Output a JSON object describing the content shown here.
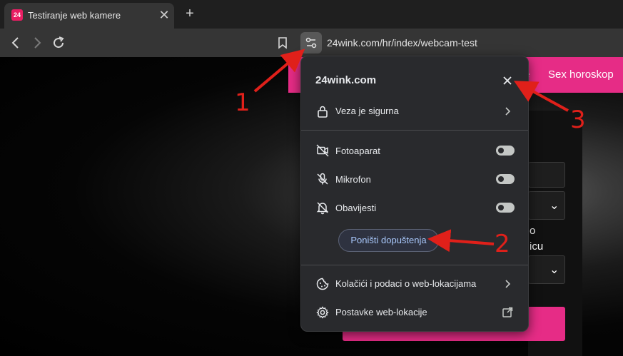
{
  "tab": {
    "favicon_text": "24",
    "title": "Testiranje web kamere",
    "close": "✕"
  },
  "new_tab": "+",
  "toolbar": {
    "url": "24wink.com/hr/index/webcam-test"
  },
  "page": {
    "nav_links": [
      "e",
      "Sex horoskop"
    ],
    "form_fragments": [
      "o",
      "icu"
    ]
  },
  "popup": {
    "site": "24wink.com",
    "connection": "Veza je sigurna",
    "permissions": [
      {
        "label": "Fotoaparat",
        "icon": "camera-off-icon",
        "enabled": false
      },
      {
        "label": "Mikrofon",
        "icon": "mic-off-icon",
        "enabled": false
      },
      {
        "label": "Obavijesti",
        "icon": "bell-off-icon",
        "enabled": false
      }
    ],
    "reset_button": "Poništi dopuštenja",
    "cookies": "Kolačići i podaci o web-lokacijama",
    "site_settings": "Postavke web-lokacije"
  },
  "annotations": [
    "1",
    "2",
    "3"
  ],
  "colors": {
    "annotation": "#e0201a",
    "brand_pink": "#e62c86",
    "link_blue": "#a8c7fa"
  }
}
